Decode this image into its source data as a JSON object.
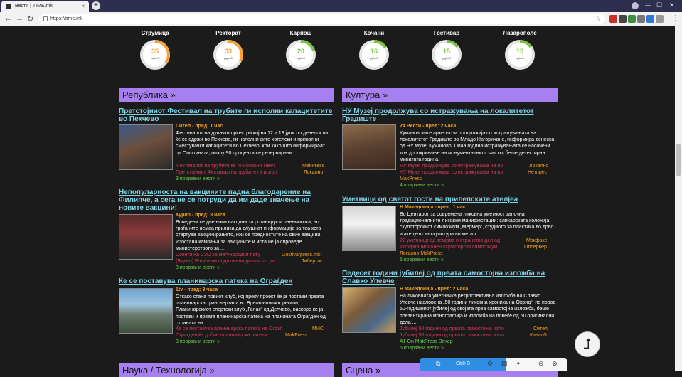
{
  "browser": {
    "tab_title": "Вести | TIME.mk",
    "tab_close": "×",
    "new_tab": "+",
    "window_min": "—",
    "window_max": "☐",
    "window_close": "✕",
    "url": "https://time.mk",
    "back": "←",
    "forward": "→",
    "reload": "↻",
    "menu": "⋮"
  },
  "air_quality": [
    {
      "city": "Струмица",
      "value": "35",
      "unit": "μg/m3",
      "fraction": 0.35,
      "color": "#f7a034"
    },
    {
      "city": "Ректорат",
      "value": "33",
      "unit": "μg/m3",
      "fraction": 0.33,
      "color": "#f7a034"
    },
    {
      "city": "Карпош",
      "value": "20",
      "unit": "μg/m3",
      "fraction": 0.2,
      "color": "#7cc242"
    },
    {
      "city": "Кочани",
      "value": "16",
      "unit": "μg/m3",
      "fraction": 0.16,
      "color": "#7cc242"
    },
    {
      "city": "Гостивар",
      "value": "15",
      "unit": "μg/m3",
      "fraction": 0.15,
      "color": "#7cc242"
    },
    {
      "city": "Лазарополе",
      "value": "15",
      "unit": "μg/m3",
      "fraction": 0.15,
      "color": "#7cc242"
    }
  ],
  "sections": {
    "left": "Република »",
    "right": "Култура »",
    "left_bottom": "Наука / Технологија »",
    "right_bottom": "Сцена »"
  },
  "left_articles": [
    {
      "title": "Претстојниот Фестивал на трубите ги исполни капацитетите во Пехчево",
      "source": "Сител - пред: 1 час",
      "snippet": "Фестивалот на дувачки оркестри кој на 12 и 13 јули по деветти пат ќе се одржи во Пехчево, ги наполни сите хотелски и приватни сместувачки капацитети во Пехчево, кои како што информираат од Општината, околу 90 проценти се резервирани.",
      "related": [
        {
          "text": "Фестивалот на трубите ќе го исполни Пехч",
          "src": "MakPress"
        },
        {
          "text": "Претстојниот Фестивал на трубите ги испол",
          "src": "Локално"
        }
      ],
      "more": "3 поврзани вести »"
    },
    {
      "title": "Непопуларноста на вакцините падна благодарение на Филипче, а сега не се потруди да им даде значење на новите вакцини!",
      "source": "Курир - пред: 3 часа",
      "snippet": "Воведени се две нови вакцини за ротавирус и пневмокока, но граѓаните немаа прилика да слушнат информација за тоа кога стартува вакцинирањето, кои се предностите на овие вакцини. Изостана кампања за вакцините и иста не ја спроведе министерството за ...",
      "related": [
        {
          "text": "Совети на СЗО за меѓународни пату",
          "src": "Gostivarpress.mk"
        },
        {
          "text": "(Видео) Родители подготвени да платат до",
          "src": "Либертас"
        }
      ],
      "more": "3 поврзани вести »"
    },
    {
      "title": "Ќе се поставува планинарска патека на Ограѓден",
      "source": "1tv - пред: 3 часа",
      "snippet": "Откако стана првиот клуб, кој преку проект ќе ја постави првата планинарска трансверзала во Брегалничкиот регион, Планинарскиот спортски клуб „Голак“ од Делчево, наскоро ќе ја постави и првата планинарска патека на планината Ограѓден од страната на ...",
      "related": [
        {
          "text": "Ќе се поставува планинарска патека на Ограѓ",
          "src": "МИС"
        },
        {
          "text": "Ограѓден ќе добие планинарска патека",
          "src": "MakPress"
        }
      ],
      "more": "3 поврзани вести »"
    }
  ],
  "right_articles": [
    {
      "title": "НУ Музеј продолжува со истражувања на локалитетот Градиште",
      "source": "24 Вести - пред: 2 часа",
      "snippet": "Кумановските археолози продолжија со истражувањата на локалитетот Градиште во Младо Нагоричане, информира денеска од НУ Музеј Куманово. Оваа година истражувањата се насочени кон доопкривање на монументалниот ѕид кој беше детектиран минатата година.",
      "related": [
        {
          "text": "НУ Музеј продолжува со истражувања на ло",
          "src": "Локално"
        },
        {
          "text": "НУ Музеј продолжува со истражувања на ло",
          "src": "Нетпрес"
        },
        {
          "text": "",
          "src": "MakPress"
        }
      ],
      "more": "4 поврзани вести »"
    },
    {
      "title": "Уметници од светот гости на прилепските ателјеа",
      "source": "Н.Македонија - пред: 1 час",
      "snippet": "Во Центарот за современа ликовна уметност започна традиционалните ликовни манифестации: сликарската колонија, скулпторскиот симпозиум „Мермер“, студиото за пластика во дрво и ателјето за скулптура во метал.",
      "related": [
        {
          "text": "22 уметници од земјава и странство дел од",
          "src": "Макфакс"
        },
        {
          "text": "Интернационален скулпторски симпозиум",
          "src": "Опсервер"
        },
        {
          "text": "",
          "src": "Локално   MakPress"
        }
      ],
      "more": "5 поврзани вести »"
    },
    {
      "title": "Педесет години јубилеј од првата самостојна изложба на Славко Упевче",
      "source": "Н.Македонија - пред: 2 часа",
      "snippet": "На ликовната уметничка ретроспективна изложба на Славко Упевче насловена „50 години ликовна хроника на Охрид“, по повод 50-годишниот јубилеј од својата прва самостојна изложба, беше презентирана монографија и изложба на повеќе од 50 оригинални дела ...",
      "related": [
        {
          "text": "Јубилеј 50 години од првата самостојна изло",
          "src": "Сител"
        },
        {
          "text": "Јубилеј 50 години од првата самостојна изло",
          "src": "Канал5"
        },
        {
          "text": "",
          "src": "А1 Он   MakPress   Вечер"
        }
      ],
      "more": "6 поврзани вести »"
    }
  ],
  "overlay": {
    "scroll_top_icon": "⮥",
    "snap_shortcut": "Ctrl+D"
  }
}
